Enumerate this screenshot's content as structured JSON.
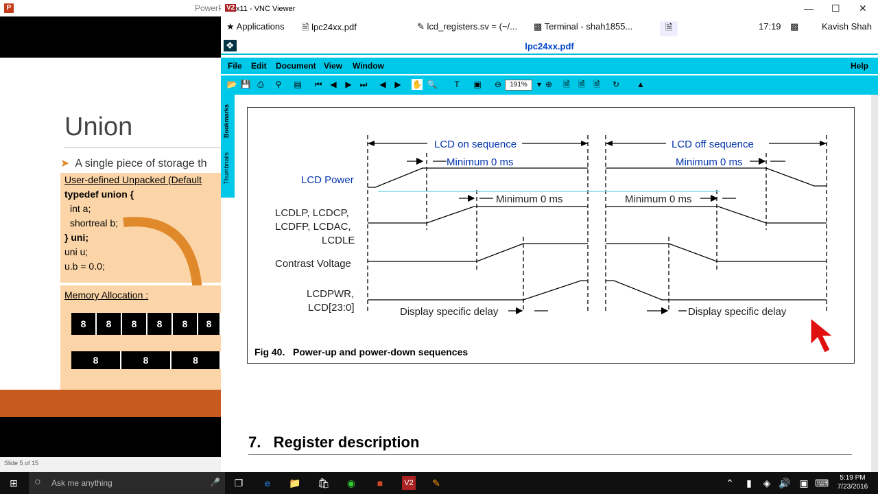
{
  "ppt": {
    "app_icon_letter": "P",
    "title": "PowerP",
    "slide_title": "Union",
    "bullet": "A single piece of storage th",
    "code_header": "User-defined Unpacked (Default",
    "code_lines": [
      "typedef union {",
      "int a;",
      "shortreal b;",
      "} uni;",
      "uni u;",
      "u.b = 0.0;"
    ],
    "memory_title": "Memory Allocation :",
    "byte_row": [
      "8",
      "8",
      "8",
      "8",
      "8",
      "8"
    ],
    "short_row": [
      "8",
      "8",
      "8"
    ],
    "status": "Slide 5 of 15"
  },
  "vnc": {
    "title": "x11 - VNC Viewer",
    "tabs": [
      "lcd_registers.sv = (~/...",
      "Terminal - shah1855..."
    ],
    "applications": "Applications",
    "pdf_task": "lpc24xx.pdf",
    "time": "17:19",
    "user": "Kavish Shah"
  },
  "pdf": {
    "window_title": "lpc24xx.pdf",
    "menus": [
      "File",
      "Edit",
      "Document",
      "View",
      "Window",
      "Help"
    ],
    "zoom": "191%",
    "side_tabs": [
      "Bookmarks",
      "Thumbnails"
    ],
    "diagram": {
      "lcd_on": "LCD on sequence",
      "lcd_off": "LCD off sequence",
      "min0": "Minimum 0 ms",
      "signals": [
        "LCD Power",
        "LCDLP, LCDCP,",
        "LCDFP, LCDAC,",
        "LCDLE",
        "Contrast Voltage",
        "LCDPWR,",
        "LCD[23:0]"
      ],
      "delay": "Display specific delay"
    },
    "figure_caption": "Fig 40.   Power-up and power-down sequences",
    "section": "7.   Register description"
  },
  "taskbar": {
    "search_placeholder": "Ask me anything",
    "time": "5:19 PM",
    "date": "7/23/2016"
  },
  "colors": {
    "cyan": "#00c8e8",
    "blue_text": "#0044cc",
    "slide_orange": "#fbd5a8"
  }
}
